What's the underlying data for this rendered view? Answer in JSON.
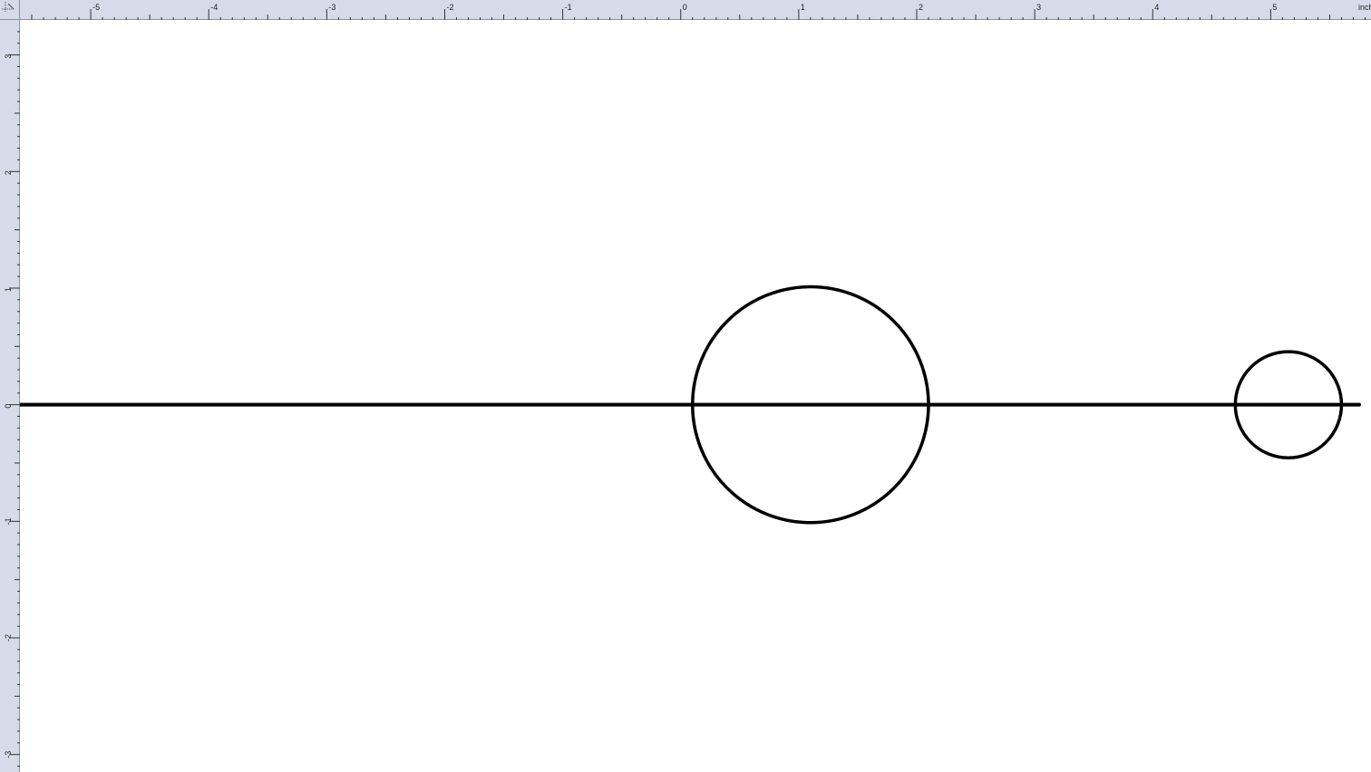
{
  "rulers": {
    "unit_label": "inches",
    "horizontal_labels": [
      "-5",
      "-4",
      "-3",
      "-2",
      "-1",
      "0",
      "1",
      "2",
      "3",
      "4",
      "5"
    ],
    "vertical_labels": [
      "3",
      "2",
      "1",
      "0",
      "-1",
      "-2",
      "-3"
    ],
    "horizontal_range": [
      -5.6,
      5.85
    ],
    "vertical_range": [
      3.3,
      -3.15
    ],
    "horizontal_values": [
      -5,
      -4,
      -3,
      -2,
      -1,
      0,
      1,
      2,
      3,
      4,
      5
    ],
    "vertical_values": [
      3,
      2,
      1,
      0,
      -1,
      -2,
      -3
    ]
  },
  "drawing": {
    "stroke_color": "#000000",
    "line": {
      "x1": -5.6,
      "y1": 0,
      "x2": 5.75,
      "y2": 0
    },
    "circles": [
      {
        "name": "large-circle",
        "cx": 1.1,
        "cy": 0,
        "r": 1.0
      },
      {
        "name": "small-circle",
        "cx": 5.15,
        "cy": 0,
        "r": 0.45
      }
    ]
  },
  "colors": {
    "ruler_bg": "#d6dbe9",
    "ruler_border": "#8a93aa",
    "canvas_bg": "#ffffff"
  }
}
